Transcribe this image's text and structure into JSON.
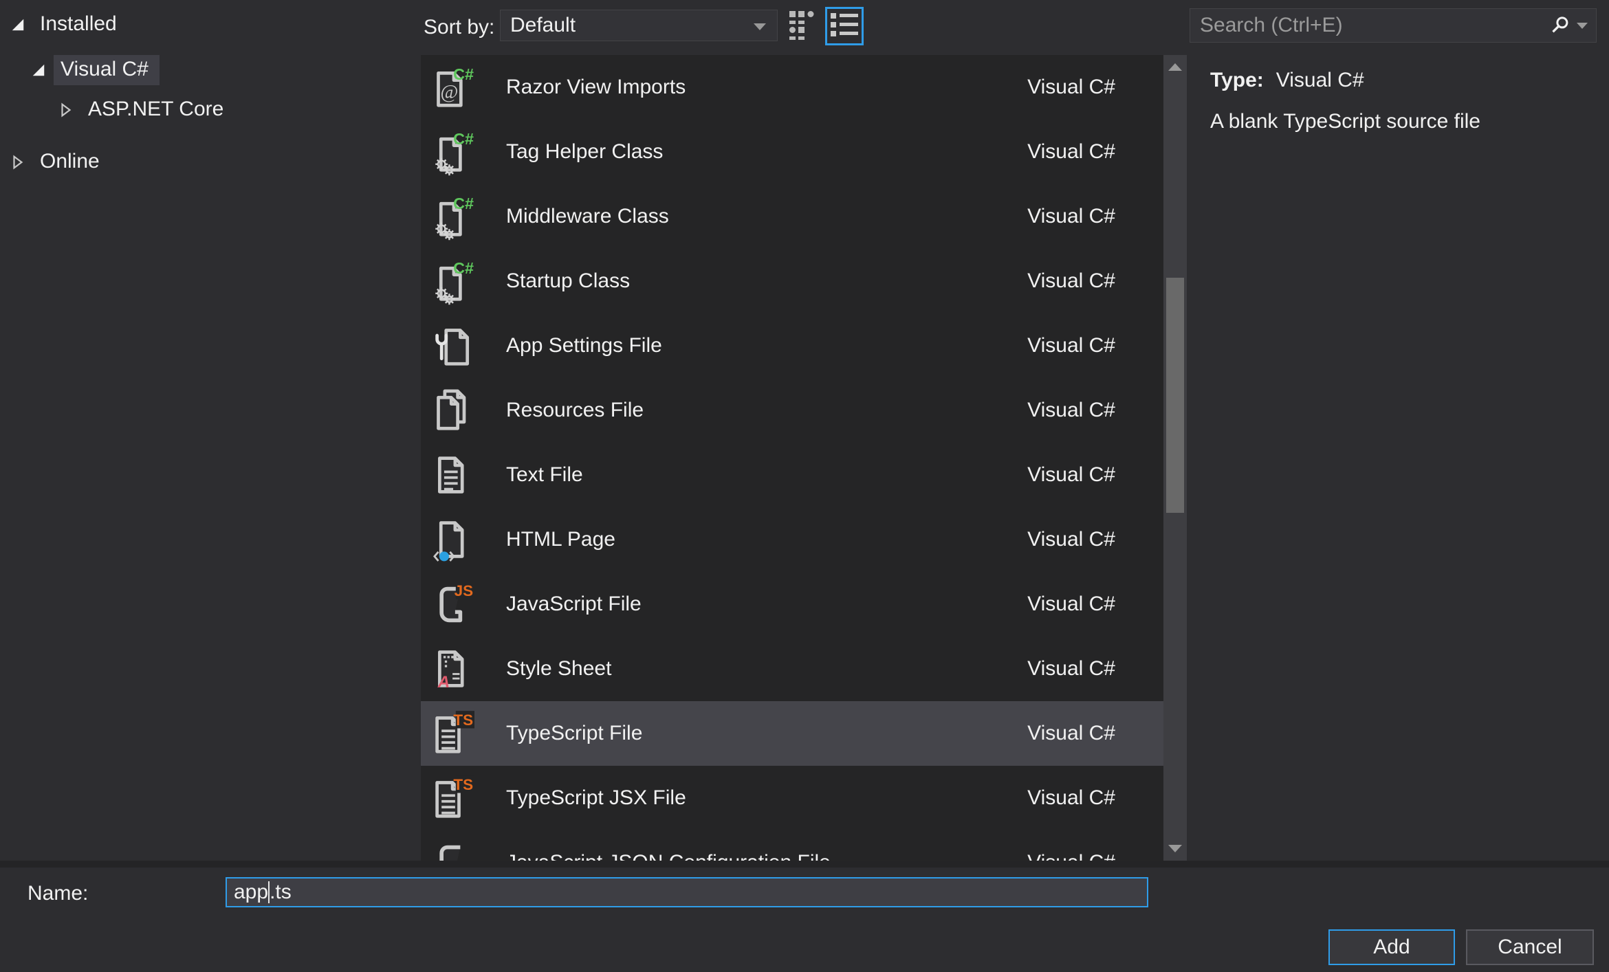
{
  "tree": {
    "items": [
      {
        "label": "Installed",
        "state": "expanded",
        "selected": false
      },
      {
        "label": "Visual C#",
        "state": "expanded",
        "selected": true
      },
      {
        "label": "ASP.NET Core",
        "state": "collapsed",
        "selected": false
      },
      {
        "label": "Online",
        "state": "collapsed",
        "selected": false
      }
    ]
  },
  "toolbar": {
    "sort_label": "Sort by:",
    "sort_value": "Default",
    "view_modes": [
      "small-icons-view",
      "list-view"
    ],
    "selected_view": "list-view"
  },
  "search": {
    "placeholder": "Search (Ctrl+E)"
  },
  "templates": {
    "rows": [
      {
        "name": "Razor View Imports",
        "language": "Visual C#",
        "icon": "csharp-razor-file-icon",
        "selected": false
      },
      {
        "name": "Tag Helper Class",
        "language": "Visual C#",
        "icon": "csharp-class-file-icon",
        "selected": false
      },
      {
        "name": "Middleware Class",
        "language": "Visual C#",
        "icon": "csharp-class-file-icon",
        "selected": false
      },
      {
        "name": "Startup Class",
        "language": "Visual C#",
        "icon": "csharp-class-file-icon",
        "selected": false
      },
      {
        "name": "App Settings File",
        "language": "Visual C#",
        "icon": "app-settings-file-icon",
        "selected": false
      },
      {
        "name": "Resources File",
        "language": "Visual C#",
        "icon": "resources-file-icon",
        "selected": false
      },
      {
        "name": "Text File",
        "language": "Visual C#",
        "icon": "text-file-icon",
        "selected": false
      },
      {
        "name": "HTML Page",
        "language": "Visual C#",
        "icon": "html-page-icon",
        "selected": false
      },
      {
        "name": "JavaScript File",
        "language": "Visual C#",
        "icon": "javascript-file-icon",
        "selected": false
      },
      {
        "name": "Style Sheet",
        "language": "Visual C#",
        "icon": "style-sheet-icon",
        "selected": false
      },
      {
        "name": "TypeScript File",
        "language": "Visual C#",
        "icon": "typescript-file-icon",
        "selected": true
      },
      {
        "name": "TypeScript JSX File",
        "language": "Visual C#",
        "icon": "typescript-file-icon",
        "selected": false
      },
      {
        "name": "JavaScript JSON Configuration File",
        "language": "Visual C#",
        "icon": "json-config-file-icon",
        "selected": false
      }
    ]
  },
  "details": {
    "type_label": "Type:",
    "type_value": "Visual C#",
    "description": "A blank TypeScript source file"
  },
  "footer": {
    "name_label": "Name:",
    "name_value": "app.ts",
    "before_caret": "app",
    "after_caret": ".ts",
    "add_label": "Add",
    "cancel_label": "Cancel"
  },
  "colors": {
    "window_bg": "#2d2d30",
    "list_bg": "#252526",
    "selected_row": "#45454b",
    "tree_selection": "#3f3f46",
    "accent_blue": "#2f9ce8",
    "csharp_green": "#5fc75d",
    "script_orange": "#e2691e",
    "style_pink": "#e05a6d",
    "html_blue": "#2ba0e0",
    "placeholder_gray": "#9b9b9b"
  }
}
